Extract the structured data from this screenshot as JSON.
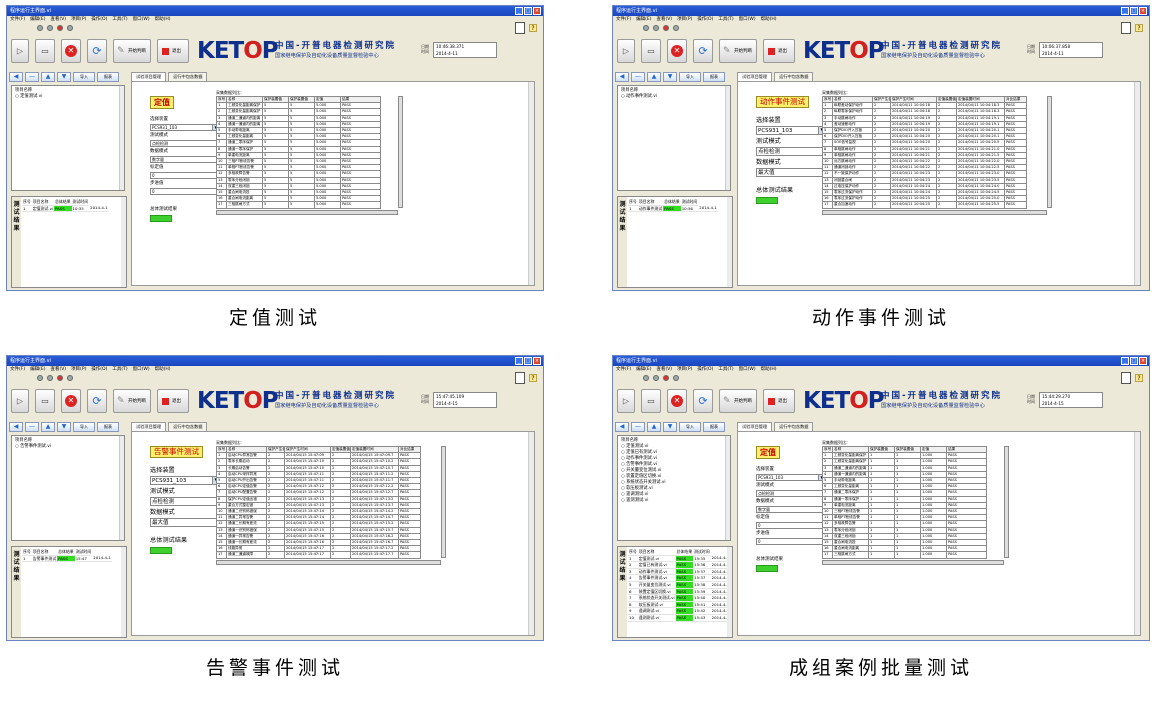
{
  "app": {
    "title": "程序运行主界面.vi",
    "menus": [
      "文件(F)",
      "编辑(E)",
      "查看(V)",
      "项目(P)",
      "操作(O)",
      "工具(T)",
      "窗口(W)",
      "帮助(H)"
    ],
    "tool_buttons": [
      "开始判断",
      "退出"
    ],
    "logo": "KETOP",
    "org_name": "中国-开普电器检测研究院",
    "org_sub": "国家继电保护及自动化设备质量监督检验中心",
    "date_labels": [
      "日期",
      "时间"
    ],
    "left_tools": [
      "导入",
      "报表"
    ],
    "tabs": [
      "试验项目管理",
      "运行中包含数据"
    ],
    "tree_header": "项目名称",
    "results_side": "测试结果",
    "results_header": [
      "序号",
      "项目名称",
      "总体结果",
      "测试时间"
    ],
    "data_caption": "采集数据列比："
  },
  "panels": [
    {
      "caption": "定值测试",
      "datetime": [
        "10:46:38.371",
        "2014-4-11"
      ],
      "tree": [
        "定值测试.vi"
      ],
      "results_rows": [
        [
          "1",
          "定值测试.vi",
          "PASS",
          "10:35",
          "2014-4-1"
        ]
      ],
      "controls": {
        "title": "定值",
        "fields": [
          {
            "label": "选择装置",
            "value": "PCS931_103",
            "dropdown": true
          },
          {
            "label": "测试模式",
            "value": "点检检测"
          },
          {
            "label": "数据模式",
            "value": "数字量"
          },
          {
            "label": "标定值",
            "value": "0"
          },
          {
            "label": "步进值",
            "value": "0"
          }
        ],
        "result_label": "总体测试结果"
      },
      "table": {
        "columns": [
          "序号",
          "名称",
          "保护装置值",
          "保护装置值",
          "定值",
          "结果"
        ],
        "rows": [
          [
            "1",
            "工频变化量距离保护",
            "5",
            "5",
            "5.000",
            "PASS"
          ],
          [
            "2",
            "工频变化量距离保护",
            "5",
            "5",
            "5.000",
            "PASS"
          ],
          [
            "3",
            "通道二通道内的距离",
            "5",
            "5",
            "5.000",
            "PASS"
          ],
          [
            "4",
            "通道一通道内的距离",
            "5",
            "5",
            "5.000",
            "PASS"
          ],
          [
            "5",
            "手动带电距离",
            "5",
            "5",
            "5.000",
            "PASS"
          ],
          [
            "6",
            "工频变化量距离",
            "5",
            "5",
            "5.000",
            "PASS"
          ],
          [
            "7",
            "通道二零序保护",
            "5",
            "5",
            "5.000",
            "PASS"
          ],
          [
            "8",
            "通道一零序保护",
            "5",
            "5",
            "5.000",
            "PASS"
          ],
          [
            "9",
            "单重电流距离",
            "5",
            "5",
            "5.000",
            "PASS"
          ],
          [
            "10",
            "三相PT断线告警",
            "5",
            "5",
            "5.000",
            "PASS"
          ],
          [
            "11",
            "单相PT断线告警",
            "5",
            "5",
            "5.000",
            "PASS"
          ],
          [
            "12",
            "多相故障告警",
            "5",
            "5",
            "5.000",
            "PASS"
          ],
          [
            "13",
            "零序分段闭锁",
            "5",
            "5",
            "5.000",
            "PASS"
          ],
          [
            "14",
            "双重三段闭锁",
            "5",
            "5",
            "5.000",
            "PASS"
          ],
          [
            "15",
            "重合闸电流投",
            "5",
            "5",
            "5.000",
            "PASS"
          ],
          [
            "16",
            "重合闸电流距离",
            "5",
            "5",
            "5.000",
            "PASS"
          ],
          [
            "17",
            "三相跳闸方式",
            "5",
            "5",
            "5.000",
            "PASS"
          ]
        ]
      }
    },
    {
      "caption": "动作事件测试",
      "datetime": [
        "10:06:37.858",
        "2014-4-11"
      ],
      "tree": [
        "动作事件测试.vi"
      ],
      "results_rows": [
        [
          "1",
          "动作事件测试",
          "PASS",
          "10:56",
          "2014-4-1"
        ]
      ],
      "controls": {
        "title": "动作事件测试",
        "fields": [
          {
            "label": "选择装置",
            "value": "PCS931_103",
            "dropdown": true
          },
          {
            "label": "测试模式",
            "value": "点检检测"
          },
          {
            "label": "数据模式",
            "value": "最大值"
          }
        ],
        "result_label": "总体测试结果"
      },
      "table": {
        "columns": [
          "序号",
          "名称",
          "保护产生值",
          "保护产生时间",
          "定值装置值",
          "定值装置时间",
          "对比结果"
        ],
        "rows": [
          [
            "1",
            "纵联差动保护动作",
            "2",
            "2014/04/11 10:04:18",
            "2",
            "2014/04/11 10:04:18.3",
            "PASS"
          ],
          [
            "2",
            "纵联零序保护动作",
            "2",
            "2014/04/11 10:04:18",
            "2",
            "2014/04/11 10:04:18.3",
            "PASS"
          ],
          [
            "3",
            "手动跳闸动作",
            "2",
            "2014/04/11 10:04:19",
            "2",
            "2014/04/11 10:04:19.1",
            "PASS"
          ],
          [
            "4",
            "差动速断动作",
            "2",
            "2014/04/11 10:04:19",
            "2",
            "2014/04/11 10:04:19.1",
            "PASS"
          ],
          [
            "5",
            "保护DIO开入压板",
            "2",
            "2014/04/11 10:04:20",
            "2",
            "2014/04/11 10:04:20.1",
            "PASS"
          ],
          [
            "6",
            "保护DIO开入压板",
            "2",
            "2014/04/11 10:04:20",
            "2",
            "2014/04/11 10:04:20.1",
            "PASS"
          ],
          [
            "7",
            "SOE信号监视",
            "2",
            "2014/04/11 10:04:20",
            "2",
            "2014/04/11 10:04:20.5",
            "PASS"
          ],
          [
            "8",
            "单相跳闸动作",
            "2",
            "2014/04/11 10:04:21",
            "2",
            "2014/04/11 10:04:21.0",
            "PASS"
          ],
          [
            "9",
            "单相跳闸动作",
            "2",
            "2014/04/11 10:04:21",
            "2",
            "2014/04/11 10:04:21.5",
            "PASS"
          ],
          [
            "10",
            "远方跳闸动作",
            "2",
            "2014/04/11 10:04:22",
            "2",
            "2014/04/11 10:04:22.0",
            "PASS"
          ],
          [
            "11",
            "通道闭锁动作",
            "2",
            "2014/04/11 10:04:22",
            "2",
            "2014/04/11 10:04:22.5",
            "PASS"
          ],
          [
            "12",
            "不一致保护动作",
            "2",
            "2014/04/11 10:04:23",
            "2",
            "2014/04/11 10:04:23.0",
            "PASS"
          ],
          [
            "13",
            "闭锁重合闸",
            "2",
            "2014/04/11 10:04:23",
            "2",
            "2014/04/11 10:04:23.5",
            "PASS"
          ],
          [
            "14",
            "过电压保护动作",
            "2",
            "2014/04/11 10:04:24",
            "2",
            "2014/04/11 10:04:24.0",
            "PASS"
          ],
          [
            "15",
            "零序过流保护动作",
            "2",
            "2014/04/11 10:04:24",
            "2",
            "2014/04/11 10:04:24.5",
            "PASS"
          ],
          [
            "16",
            "零序过流保护动作",
            "2",
            "2014/04/11 10:04:25",
            "2",
            "2014/04/11 10:04:25.0",
            "PASS"
          ],
          [
            "17",
            "重合加速动作",
            "2",
            "2014/04/11 10:04:25",
            "2",
            "2014/04/11 10:04:25.5",
            "PASS"
          ]
        ]
      }
    },
    {
      "caption": "告警事件测试",
      "datetime": [
        "15:47:45.109",
        "2014-4-15"
      ],
      "tree": [
        "告警事件测试.vi"
      ],
      "results_rows": [
        [
          "1",
          "告警事件测试",
          "PASS",
          "15:47",
          "2014-4-1"
        ]
      ],
      "controls": {
        "title": "告警事件测试",
        "fields": [
          {
            "label": "选择装置",
            "value": "PCS931_103",
            "dropdown": true
          },
          {
            "label": "测试模式",
            "value": "点检检测"
          },
          {
            "label": "数据模式",
            "value": "最大值"
          }
        ],
        "result_label": "总体测试结果"
      },
      "table": {
        "columns": [
          "序号",
          "名称",
          "保护产生值",
          "保护产生时间",
          "定值装置值",
          "定值装置时间",
          "对比结果"
        ],
        "rows": [
          [
            "1",
            "启动CPU异常告警",
            "2",
            "2014/04/15 15:47:09",
            "2",
            "2014/04/15 15:47:09.7",
            "PASS"
          ],
          [
            "2",
            "零序长期启动",
            "2",
            "2014/04/15 15:47:10",
            "2",
            "2014/04/15 15:47:10.2",
            "PASS"
          ],
          [
            "3",
            "长期启动告警",
            "2",
            "2014/04/15 15:47:10",
            "2",
            "2014/04/15 15:47:10.7",
            "PASS"
          ],
          [
            "4",
            "启动CPU采样异常",
            "2",
            "2014/04/15 15:47:11",
            "2",
            "2014/04/15 15:47:11.2",
            "PASS"
          ],
          [
            "5",
            "启动CPU开出告警",
            "2",
            "2014/04/15 15:47:11",
            "2",
            "2014/04/15 15:47:11.7",
            "PASS"
          ],
          [
            "6",
            "启动CPU定值告警",
            "2",
            "2014/04/15 15:47:12",
            "2",
            "2014/04/15 15:47:12.2",
            "PASS"
          ],
          [
            "7",
            "启动CPU配置告警",
            "2",
            "2014/04/15 15:47:12",
            "2",
            "2014/04/15 15:47:12.7",
            "PASS"
          ],
          [
            "8",
            "保护CPU定值出错",
            "2",
            "2014/04/15 15:47:13",
            "2",
            "2014/04/15 15:47:13.2",
            "PASS"
          ],
          [
            "9",
            "重合方式整定错",
            "2",
            "2014/04/15 15:47:13",
            "2",
            "2014/04/15 15:47:13.7",
            "PASS"
          ],
          [
            "10",
            "通道二识别码错误",
            "2",
            "2014/04/15 15:47:14",
            "2",
            "2014/04/15 15:47:14.2",
            "PASS"
          ],
          [
            "11",
            "通道二异常告警",
            "2",
            "2014/04/15 15:47:14",
            "2",
            "2014/04/15 15:47:14.7",
            "PASS"
          ],
          [
            "12",
            "通道二长期有差流",
            "2",
            "2014/04/15 15:47:15",
            "2",
            "2014/04/15 15:47:15.2",
            "PASS"
          ],
          [
            "13",
            "通道一识别码错误",
            "2",
            "2014/04/15 15:47:15",
            "2",
            "2014/04/15 15:47:15.7",
            "PASS"
          ],
          [
            "14",
            "通道一异常告警",
            "2",
            "2014/04/15 15:47:16",
            "2",
            "2014/04/15 15:47:16.2",
            "PASS"
          ],
          [
            "15",
            "通道一长期有差流",
            "2",
            "2014/04/15 15:47:16",
            "2",
            "2014/04/15 15:47:16.7",
            "PASS"
          ],
          [
            "16",
            "线路异常",
            "2",
            "2014/04/15 15:47:17",
            "2",
            "2014/04/15 15:47:17.2",
            "PASS"
          ],
          [
            "17",
            "通道二通道故障",
            "2",
            "2014/04/15 15:47:17",
            "2",
            "2014/04/15 15:47:17.7",
            "PASS"
          ]
        ]
      }
    },
    {
      "caption": "成组案例批量测试",
      "datetime": [
        "15:44:29.270",
        "2014-4-15"
      ],
      "tree": [
        "定值测试.vi",
        "定值已有测试.vi",
        "动作事件测试.vi",
        "告警事件测试.vi",
        "开关量变位测试.vi",
        "装置定值区切换.vi",
        "系统状态开关测试.vi",
        "软压板测试.vi",
        "遥调测试.vi",
        "遥测测试.vi"
      ],
      "results_rows": [
        [
          "1",
          "定值测试.vi",
          "PASS",
          "15:35",
          "2014-4-1"
        ],
        [
          "2",
          "定值已有测试.vi",
          "PASS",
          "15:36",
          "2014-4-1"
        ],
        [
          "3",
          "动作事件测试.vi",
          "PASS",
          "15:37",
          "2014-4-1"
        ],
        [
          "4",
          "告警事件测试.vi",
          "PASS",
          "15:37",
          "2014-4-1"
        ],
        [
          "5",
          "开关量变位测试.vi",
          "PASS",
          "15:38",
          "2014-4-1"
        ],
        [
          "6",
          "装置定值区切换.vi",
          "PASS",
          "15:39",
          "2014-4-1"
        ],
        [
          "7",
          "系统状态开关测试.vi",
          "PASS",
          "15:40",
          "2014-4-1"
        ],
        [
          "8",
          "软压板测试.vi",
          "PASS",
          "15:41",
          "2014-4-1"
        ],
        [
          "9",
          "遥调测试.vi",
          "PASS",
          "15:42",
          "2014-4-1"
        ],
        [
          "10",
          "遥测测试.vi",
          "PASS",
          "15:43",
          "2014-4-1"
        ]
      ],
      "controls": {
        "title": "定值",
        "fields": [
          {
            "label": "选择装置",
            "value": "PCS931_103",
            "dropdown": true
          },
          {
            "label": "测试模式",
            "value": "点检检测"
          },
          {
            "label": "数据模式",
            "value": "数字量"
          },
          {
            "label": "标定值",
            "value": "0"
          },
          {
            "label": "步进值",
            "value": "0"
          }
        ],
        "result_label": "总体测试结果"
      },
      "table": {
        "columns": [
          "序号",
          "名称",
          "保护装置值",
          "保护装置值",
          "定值",
          "结果"
        ],
        "rows": [
          [
            "1",
            "工频变化量距离保护",
            "1",
            "1",
            "1.000",
            "PASS"
          ],
          [
            "2",
            "工频变化量距离保护",
            "1",
            "1",
            "1.000",
            "PASS"
          ],
          [
            "3",
            "通道二通道内的距离",
            "1",
            "1",
            "1.000",
            "PASS"
          ],
          [
            "4",
            "通道一通道内的距离",
            "1",
            "1",
            "1.000",
            "PASS"
          ],
          [
            "5",
            "手动带电距离",
            "1",
            "1",
            "1.000",
            "PASS"
          ],
          [
            "6",
            "工频变化量距离",
            "1",
            "1",
            "1.000",
            "PASS"
          ],
          [
            "7",
            "通道二零序保护",
            "1",
            "1",
            "1.000",
            "PASS"
          ],
          [
            "8",
            "通道一零序保护",
            "1",
            "1",
            "1.000",
            "PASS"
          ],
          [
            "9",
            "单重电流距离",
            "1",
            "1",
            "1.000",
            "PASS"
          ],
          [
            "10",
            "三相PT断线告警",
            "1",
            "1",
            "1.000",
            "PASS"
          ],
          [
            "11",
            "单相PT断线告警",
            "1",
            "1",
            "1.000",
            "PASS"
          ],
          [
            "12",
            "多相故障告警",
            "1",
            "1",
            "1.000",
            "PASS"
          ],
          [
            "13",
            "零序分段闭锁",
            "1",
            "1",
            "1.000",
            "PASS"
          ],
          [
            "14",
            "双重三段闭锁",
            "1",
            "1",
            "1.000",
            "PASS"
          ],
          [
            "15",
            "重合闸电流投",
            "1",
            "1",
            "1.000",
            "PASS"
          ],
          [
            "16",
            "重合闸电流距离",
            "1",
            "1",
            "1.000",
            "PASS"
          ],
          [
            "17",
            "三相跳闸方式",
            "1",
            "1",
            "1.000",
            "PASS"
          ]
        ]
      }
    }
  ]
}
